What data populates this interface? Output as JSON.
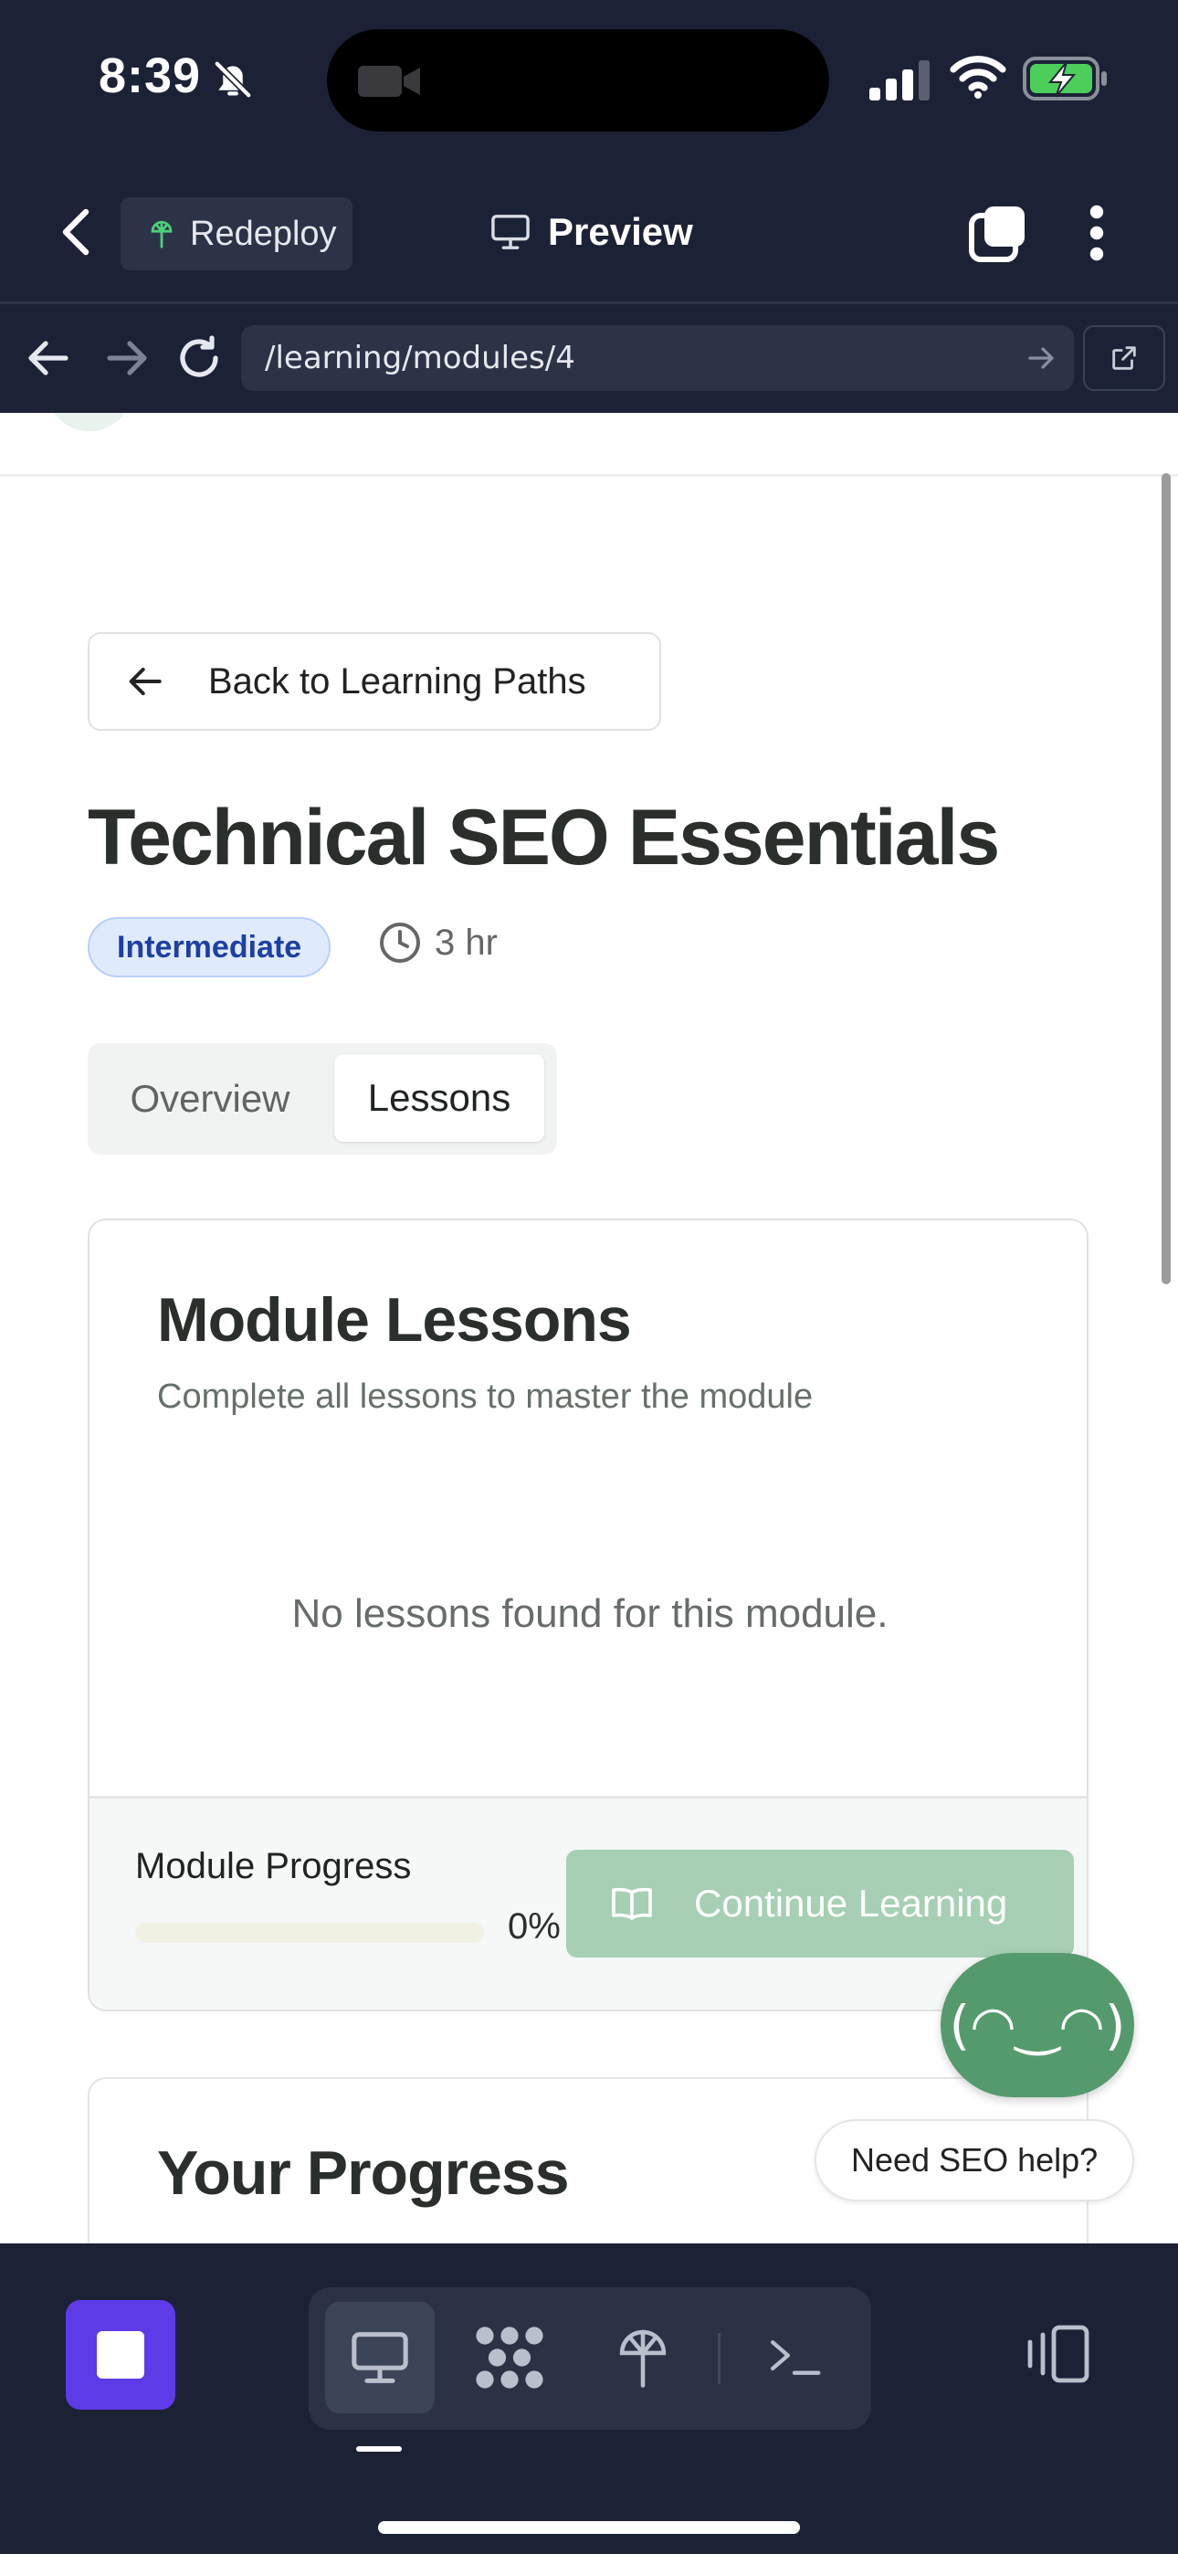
{
  "status_bar": {
    "time": "8:39"
  },
  "app_bar": {
    "redeploy_label": "Redeploy",
    "preview_label": "Preview"
  },
  "browser": {
    "url": "/learning/modules/4"
  },
  "page": {
    "back_label": "Back to Learning Paths",
    "title": "Technical SEO Essentials",
    "level": "Intermediate",
    "duration": "3 hr",
    "tabs": [
      {
        "label": "Overview",
        "active": false
      },
      {
        "label": "Lessons",
        "active": true
      }
    ],
    "lessons_card": {
      "title": "Module Lessons",
      "subtitle": "Complete all lessons to master the module",
      "empty_message": "No lessons found for this module.",
      "progress_label": "Module Progress",
      "progress_percent": "0%",
      "progress_value": 0,
      "continue_label": "Continue Learning"
    },
    "progress_card": {
      "title": "Your Progress"
    },
    "assistant": {
      "face": "(◠‿◠)",
      "help_label": "Need SEO help?"
    }
  },
  "colors": {
    "chrome_bg": "#1c2236",
    "accent_green": "#559a6c",
    "badge_blue": "#1e3fa3",
    "stop_purple": "#5d3be6"
  },
  "icons": {
    "status": [
      "bell-slash-icon",
      "signal-icon",
      "wifi-icon",
      "battery-charging-icon"
    ],
    "toolbar": [
      "desktop-icon",
      "dots-grid-icon",
      "deploy-icon",
      "terminal-icon",
      "devices-icon"
    ]
  }
}
